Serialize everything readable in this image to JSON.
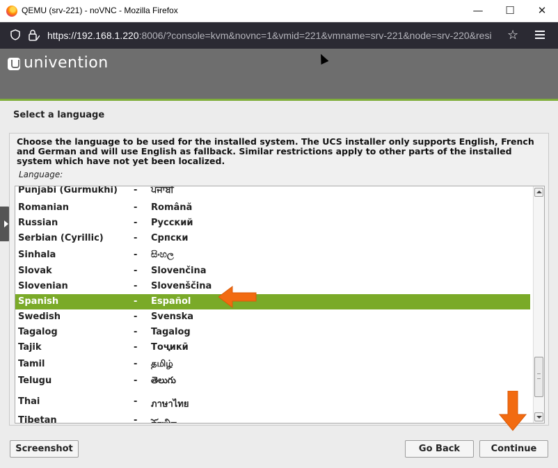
{
  "window": {
    "title": "QEMU (srv-221) - noVNC - Mozilla Firefox",
    "minimize_glyph": "—",
    "maximize_glyph": "☐",
    "close_glyph": "✕"
  },
  "urlbar": {
    "url_prefix": "https://192.168.1.220",
    "url_rest": ":8006/?console=kvm&novnc=1&vmid=221&vmname=srv-221&node=srv-220&resi"
  },
  "installer": {
    "brand": "univention",
    "step_title": "Select a language",
    "intro": "Choose the language to be used for the installed system. The UCS installer only supports English, French and German and will use English as fallback. Similar restrictions apply to other parts of the installed system which have not yet been localized.",
    "list_label": "Language:",
    "selected_language": "Spanish",
    "languages": [
      {
        "english": "Punjabi (Gurmukhi)",
        "dash": "-",
        "native": "ਪੰਜਾਬੀ"
      },
      {
        "english": "Romanian",
        "dash": "-",
        "native": "Română"
      },
      {
        "english": "Russian",
        "dash": "-",
        "native": "Русский"
      },
      {
        "english": "Serbian (Cyrillic)",
        "dash": "-",
        "native": "Српски"
      },
      {
        "english": "Sinhala",
        "dash": "-",
        "native": "සිංහල"
      },
      {
        "english": "Slovak",
        "dash": "-",
        "native": "Slovenčina"
      },
      {
        "english": "Slovenian",
        "dash": "-",
        "native": "Slovenščina"
      },
      {
        "english": "Spanish",
        "dash": "-",
        "native": "Español"
      },
      {
        "english": "Swedish",
        "dash": "-",
        "native": "Svenska"
      },
      {
        "english": "Tagalog",
        "dash": "-",
        "native": "Tagalog"
      },
      {
        "english": "Tajik",
        "dash": "-",
        "native": "Тоҷикӣ"
      },
      {
        "english": "Tamil",
        "dash": "-",
        "native": "தமிழ்"
      },
      {
        "english": "Telugu",
        "dash": "-",
        "native": "తెలుగు"
      },
      {
        "english": "Thai",
        "dash": "-",
        "native": "ภาษาไทย"
      },
      {
        "english": "Tibetan",
        "dash": "-",
        "native": "བོད་ཡིག"
      }
    ],
    "buttons": {
      "screenshot": "Screenshot",
      "go_back": "Go Back",
      "continue": "Continue"
    }
  },
  "colors": {
    "header_bg": "#6e6e6e",
    "accent_green": "#7aaa28",
    "annotation_arrow": "#f26b11",
    "urlbar_bg": "#2b2a33"
  }
}
